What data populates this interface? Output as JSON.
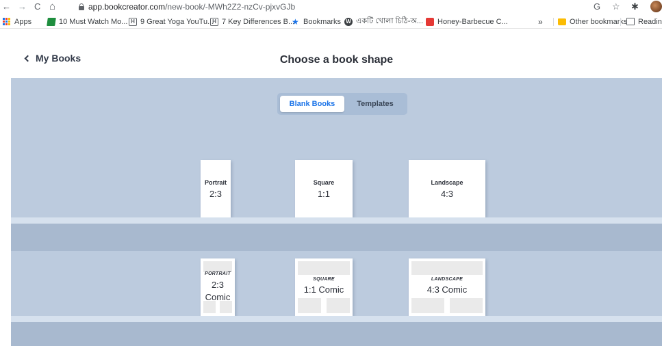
{
  "browser": {
    "back_glyph": "←",
    "forward_glyph": "→",
    "reload_glyph": "C",
    "home_glyph": "⌂",
    "url_host": "app.bookcreator.com",
    "url_path": "/new-book/-MWh2Z2-nzCv-pjxvGJb",
    "right_icons": [
      "G",
      "☆",
      "✱"
    ],
    "bookmarks": [
      {
        "label": "Apps",
        "icon": "apps-grid-icon"
      },
      {
        "label": "10 Must Watch Mo...",
        "icon": "green-bookmark-icon"
      },
      {
        "label": "9 Great Yoga YouTu...",
        "icon": "h-box-icon",
        "glyph": "H"
      },
      {
        "label": "7 Key Differences B...",
        "icon": "h-box-icon",
        "glyph": "H"
      },
      {
        "label": "Bookmarks",
        "icon": "star-icon",
        "glyph": "★"
      },
      {
        "label": "একটি খোলা চিঠি-অ...",
        "icon": "wordpress-icon",
        "glyph": "W"
      },
      {
        "label": "Honey-Barbecue C...",
        "icon": "red-bookmark-icon"
      }
    ],
    "overflow_label": "»",
    "other_bookmarks": "Other bookmarks",
    "reading_list": "Reading"
  },
  "header": {
    "back_label": "My Books",
    "title": "Choose a book shape"
  },
  "toggle": {
    "blank": "Blank Books",
    "templates": "Templates"
  },
  "books": [
    {
      "label": "Portrait",
      "ratio": "2:3"
    },
    {
      "label": "Square",
      "ratio": "1:1"
    },
    {
      "label": "Landscape",
      "ratio": "4:3"
    }
  ],
  "comics": [
    {
      "label": "PORTRAIT",
      "ratio_line1": "2:3",
      "ratio_line2": "Comic"
    },
    {
      "label": "SQUARE",
      "ratio": "1:1 Comic"
    },
    {
      "label": "LANDSCAPE",
      "ratio": "4:3 Comic"
    }
  ],
  "colors": {
    "shelf_background": "#bccbde",
    "accent": "#1a73e8"
  }
}
